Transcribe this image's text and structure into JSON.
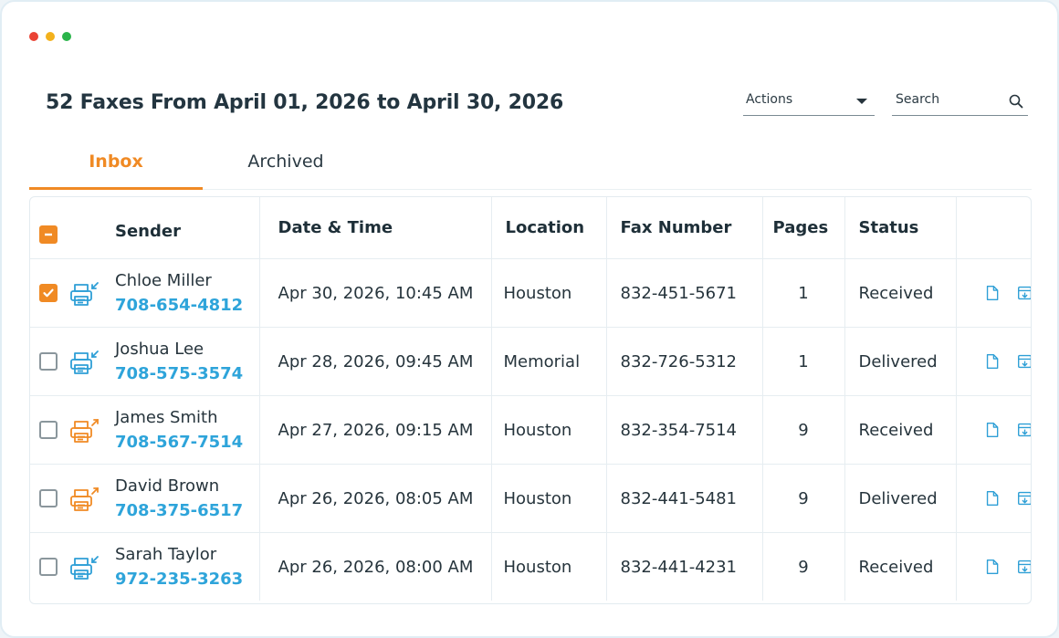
{
  "window": {
    "dots": [
      "#ea4335",
      "#f3b11c",
      "#2ab44a"
    ]
  },
  "header": {
    "title": "52 Faxes From April 01, 2026 to April 30, 2026",
    "actions_label": "Actions",
    "search_placeholder": "Search"
  },
  "tabs": [
    {
      "label": "Inbox",
      "active": true
    },
    {
      "label": "Archived",
      "active": false
    }
  ],
  "table": {
    "columns": [
      "Sender",
      "Date & Time",
      "Location",
      "Fax Number",
      "Pages",
      "Status"
    ],
    "rows": [
      {
        "checked": true,
        "direction": "incoming",
        "name": "Chloe Miller",
        "phone": "708-654-4812",
        "datetime": "Apr 30, 2026, 10:45 AM",
        "location": "Houston",
        "fax": "832-451-5671",
        "pages": "1",
        "status": "Received"
      },
      {
        "checked": false,
        "direction": "incoming",
        "name": "Joshua Lee",
        "phone": "708-575-3574",
        "datetime": "Apr 28, 2026, 09:45 AM",
        "location": "Memorial",
        "fax": "832-726-5312",
        "pages": "1",
        "status": "Delivered"
      },
      {
        "checked": false,
        "direction": "outgoing",
        "name": "James Smith",
        "phone": "708-567-7514",
        "datetime": "Apr 27, 2026, 09:15 AM",
        "location": "Houston",
        "fax": "832-354-7514",
        "pages": "9",
        "status": "Received"
      },
      {
        "checked": false,
        "direction": "outgoing",
        "name": "David Brown",
        "phone": "708-375-6517",
        "datetime": "Apr 26, 2026, 08:05 AM",
        "location": "Houston",
        "fax": "832-441-5481",
        "pages": "9",
        "status": "Delivered"
      },
      {
        "checked": false,
        "direction": "incoming",
        "name": "Sarah Taylor",
        "phone": "972-235-3263",
        "datetime": "Apr 26, 2026, 08:00 AM",
        "location": "Houston",
        "fax": "832-441-4231",
        "pages": "9",
        "status": "Received"
      }
    ]
  },
  "icons": {
    "incoming": "fax-incoming-icon",
    "outgoing": "fax-outgoing-icon",
    "view": "document-icon",
    "archive": "archive-icon"
  },
  "colors": {
    "accent": "#f08a24",
    "link": "#2ea4da",
    "incoming_icon": "#2e9fd6",
    "outgoing_icon": "#f08a24"
  }
}
